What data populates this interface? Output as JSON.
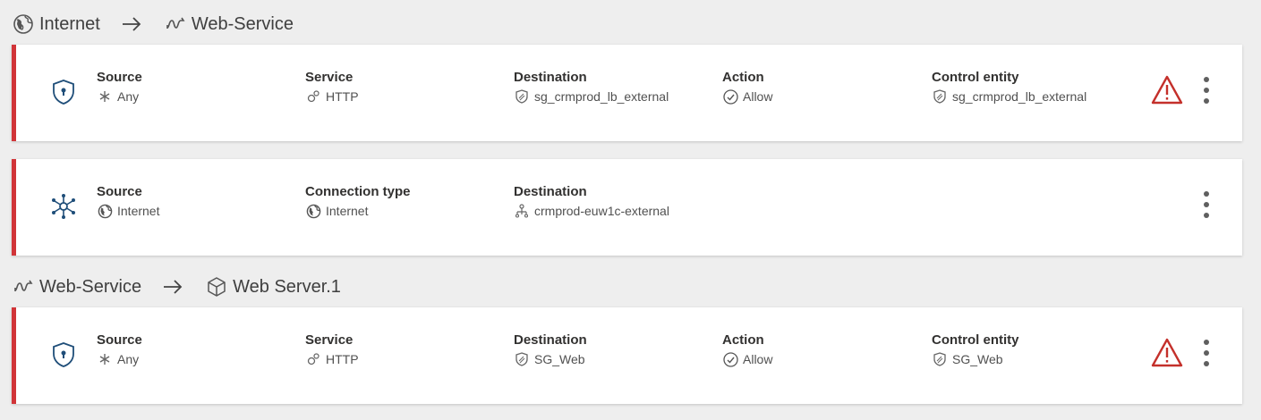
{
  "paths": [
    {
      "from": "Internet",
      "to": "Web-Service"
    },
    {
      "from": "Web-Service",
      "to": "Web Server.1"
    }
  ],
  "rule1": {
    "source_label": "Source",
    "source_value": "Any",
    "service_label": "Service",
    "service_value": "HTTP",
    "dest_label": "Destination",
    "dest_value": "sg_crmprod_lb_external",
    "action_label": "Action",
    "action_value": "Allow",
    "control_label": "Control entity",
    "control_value": "sg_crmprod_lb_external"
  },
  "conn1": {
    "source_label": "Source",
    "source_value": "Internet",
    "conn_label": "Connection type",
    "conn_value": "Internet",
    "dest_label": "Destination",
    "dest_value": "crmprod-euw1c-external"
  },
  "rule2": {
    "source_label": "Source",
    "source_value": "Any",
    "service_label": "Service",
    "service_value": "HTTP",
    "dest_label": "Destination",
    "dest_value": "SG_Web",
    "action_label": "Action",
    "action_value": "Allow",
    "control_label": "Control entity",
    "control_value": "SG_Web"
  },
  "colors": {
    "accent_border": "#d13438",
    "warning": "#c4302b",
    "icon_blue": "#1f4e79"
  }
}
